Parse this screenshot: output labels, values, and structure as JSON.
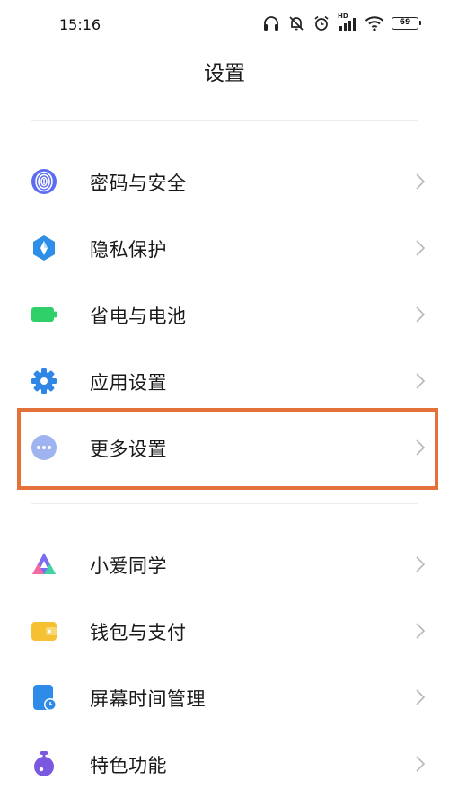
{
  "status_bar": {
    "time": "15:16",
    "network_label": "HD",
    "battery_level": "69",
    "icons": [
      "headphones-icon",
      "mute-icon",
      "alarm-icon",
      "signal-icon",
      "wifi-icon",
      "battery-icon"
    ]
  },
  "header": {
    "title": "设置"
  },
  "groups": [
    {
      "items": [
        {
          "label": "密码与安全",
          "icon": "fingerprint-icon",
          "color": "#5b6cf2"
        },
        {
          "label": "隐私保护",
          "icon": "privacy-shield-icon",
          "color": "#2e8fe8"
        },
        {
          "label": "省电与电池",
          "icon": "battery-saver-icon",
          "color": "#2fd06a"
        },
        {
          "label": "应用设置",
          "icon": "app-settings-gear-icon",
          "color": "#2f86e6"
        },
        {
          "label": "更多设置",
          "icon": "more-dots-icon",
          "color": "#9fb3f0",
          "highlighted": true
        }
      ]
    },
    {
      "items": [
        {
          "label": "小爱同学",
          "icon": "xiaoai-assistant-icon",
          "color": "#7b6cf0"
        },
        {
          "label": "钱包与支付",
          "icon": "wallet-icon",
          "color": "#f5c132"
        },
        {
          "label": "屏幕时间管理",
          "icon": "screen-time-icon",
          "color": "#2f8be8"
        },
        {
          "label": "特色功能",
          "icon": "special-features-icon",
          "color": "#7a58e0"
        }
      ]
    }
  ],
  "highlight_color": "#e4703a"
}
